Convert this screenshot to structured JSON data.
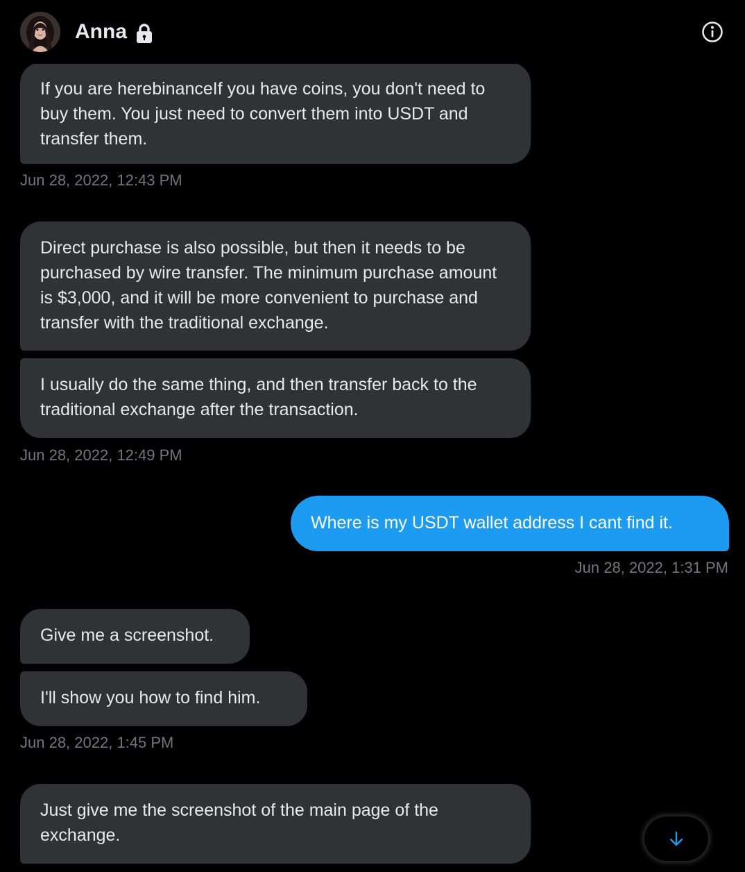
{
  "header": {
    "contact_name": "Anna",
    "avatar_icon": "avatar-photo",
    "lock_icon": "lock-icon",
    "info_icon": "info-icon"
  },
  "messages": [
    {
      "direction": "incoming",
      "text": "If you are herebinanceIf you have coins, you don't need to buy them. You just need to convert them into USDT and transfer them."
    },
    {
      "direction": "incoming",
      "text": "Direct purchase is also possible, but then it needs to be purchased by wire transfer. The minimum purchase amount is $3,000, and it will be more convenient to purchase and transfer with the traditional exchange."
    },
    {
      "direction": "incoming",
      "text": "I usually do the same thing, and then transfer back to the traditional exchange after the transaction."
    },
    {
      "direction": "outgoing",
      "text": "Where is my USDT wallet address I cant find it."
    },
    {
      "direction": "incoming",
      "text": "Give me a screenshot."
    },
    {
      "direction": "incoming",
      "text": "I'll show you how to find him."
    },
    {
      "direction": "incoming",
      "text": "Just give me the screenshot of the main page of the exchange."
    }
  ],
  "timestamps": [
    "Jun 28, 2022, 12:43 PM",
    "Jun 28, 2022, 12:49 PM",
    "Jun 28, 2022, 1:31 PM",
    "Jun 28, 2022, 1:45 PM"
  ],
  "scroll_button": {
    "icon": "arrow-down-icon"
  },
  "colors": {
    "background": "#000000",
    "incoming_bubble": "#2f3336",
    "outgoing_bubble": "#1d9bf0",
    "text_primary": "#e7e9ea",
    "text_secondary": "#71767b",
    "accent": "#1d9bf0"
  }
}
